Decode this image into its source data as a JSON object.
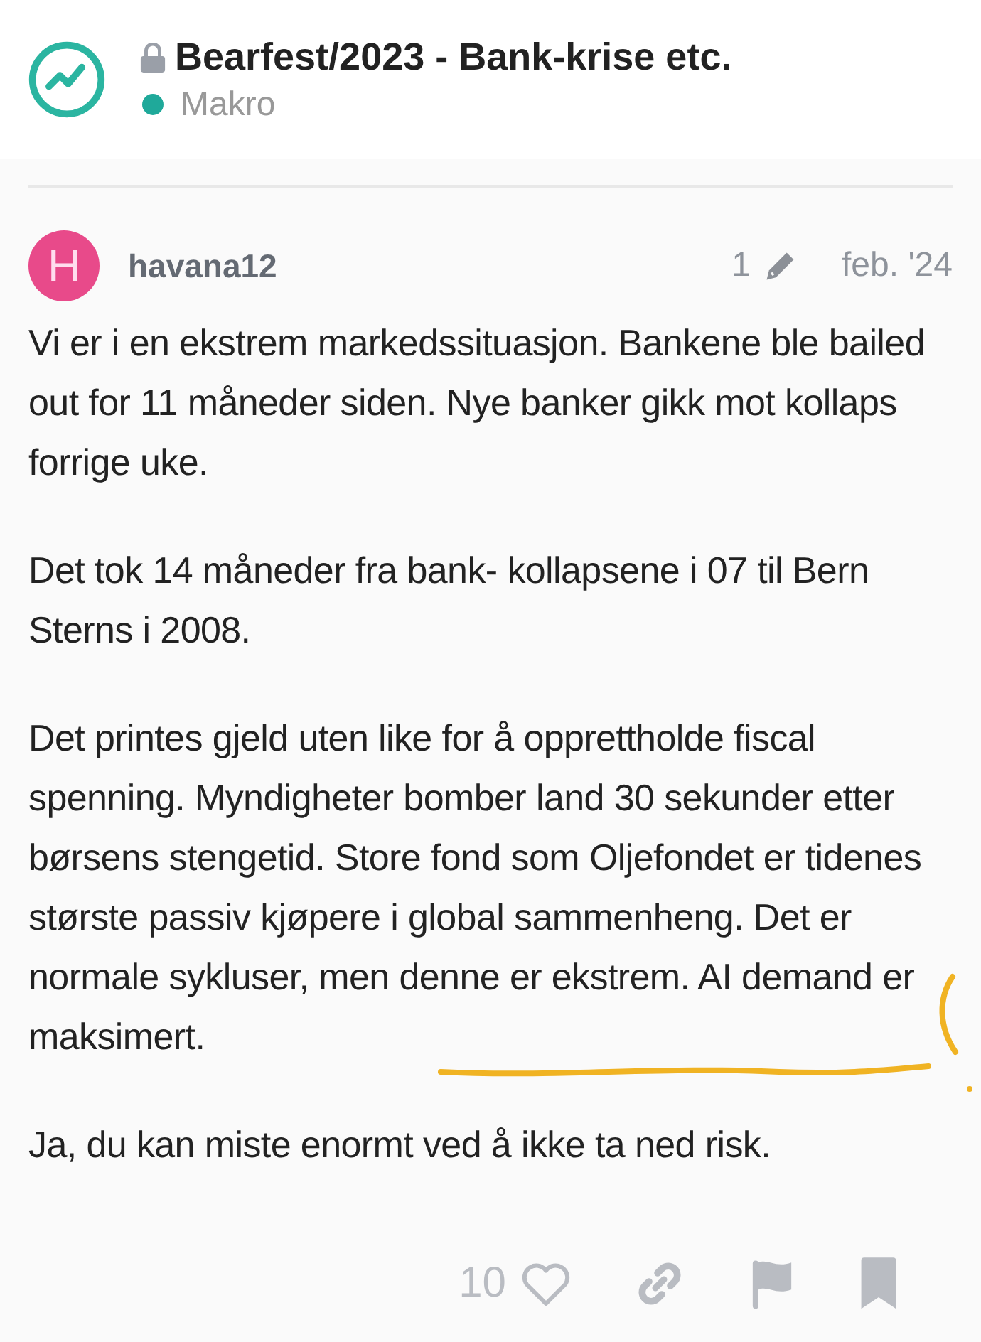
{
  "topic": {
    "title": "Bearfest/2023 - Bank-krise etc.",
    "locked": true,
    "category": {
      "name": "Makro",
      "color": "#1fa99a"
    }
  },
  "post": {
    "avatar": {
      "letter": "H",
      "color": "#e84a8a"
    },
    "username": "havana12",
    "edits": "1",
    "date": "feb. '24",
    "paragraphs": [
      {
        "text": "Vi er i en ekstrem markedssituasjon. Bankene ble bailed out for 11 måneder siden. Nye banker gikk mot kollaps forrige uke.",
        "marked": false
      },
      {
        "text": "Det tok 14 måneder fra bank- kollapsene i 07 til Bern Sterns i 2008.",
        "marked": false
      },
      {
        "text": "Det printes gjeld uten like for å opprettholde fiscal spenning. Myndigheter bomber land 30 sekunder etter børsens stengetid. Store fond som Oljefondet er tidenes største passiv kjøpere i global sammenheng. Det er normale sykluser, men denne er ekstrem. AI demand er maksimert.",
        "marked": true
      },
      {
        "text": "Ja, du kan miste enormt ved å ikke ta ned risk.",
        "marked": false
      }
    ],
    "likes": "10",
    "liked": false
  }
}
